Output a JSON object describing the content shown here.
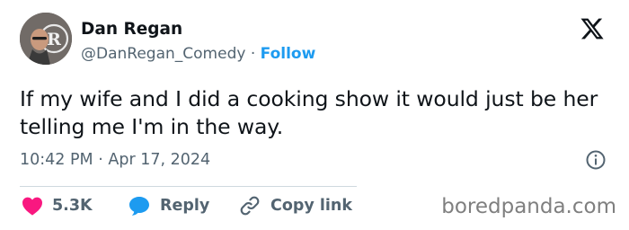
{
  "author": {
    "name": "Dan Regan",
    "handle": "@DanRegan_Comedy",
    "separator": "·",
    "follow_label": "Follow"
  },
  "tweet": {
    "text": "If my wife and I did a cooking show it would just be her telling me I'm in the way.",
    "time": "10:42 PM",
    "dot": "·",
    "date": "Apr 17, 2024"
  },
  "actions": {
    "likes_count": "5.3K",
    "reply_label": "Reply",
    "copy_link_label": "Copy link"
  },
  "watermark": "boredpanda.com",
  "colors": {
    "link_blue": "#1d9bf0",
    "heart_red": "#f91880",
    "reply_blue": "#1d9bf0",
    "muted_gray": "#536471",
    "text_black": "#0f1419"
  },
  "icons": [
    "x-logo-icon",
    "heart-icon",
    "reply-bubble-icon",
    "link-icon",
    "info-icon"
  ]
}
